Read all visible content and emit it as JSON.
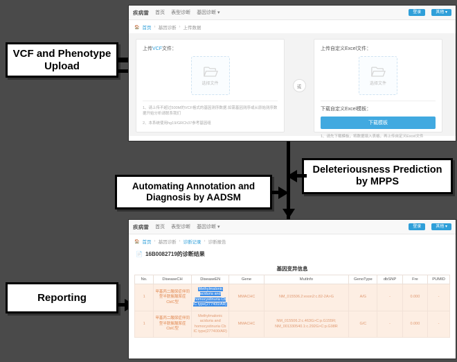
{
  "diagram": {
    "background_color": "#4a4a4a",
    "callouts": [
      {
        "id": "upload",
        "text": "VCF and Phenotype Upload"
      },
      {
        "id": "aadsm",
        "text": "Automating Annotation and Diagnosis by AADSM"
      },
      {
        "id": "mpps",
        "text": "Deleteriousness Prediction by MPPS"
      },
      {
        "id": "report",
        "text": "Reporting"
      }
    ]
  },
  "upload_window": {
    "navbar": {
      "brand": "疾病雷",
      "items": [
        {
          "label": "首页"
        },
        {
          "label": "表型诊断"
        },
        {
          "label": "基因诊断 ▾"
        }
      ],
      "buttons": [
        {
          "label": "登录"
        },
        {
          "label": "其他 ▾"
        }
      ],
      "accent_color": "#2f9fd9"
    },
    "breadcrumb": {
      "home_icon": "home-icon",
      "items": [
        "首页",
        "基因诊断",
        "上传数据"
      ]
    },
    "left_panel": {
      "label_prefix": "上传",
      "label_highlight": "VCF",
      "label_suffix": "文件：",
      "dropzone": {
        "icon": "folder-open-icon",
        "text": "选择文件"
      },
      "notes": [
        "1、请上传不超过500M的VCF格式的基因测序数据.如需基因测序或从原始测序数据开始分析请联系我们",
        "2、本系统使用hg19/GRCh37参考基因组"
      ]
    },
    "middle": {
      "or_label": "或"
    },
    "right_panel": {
      "upload_label": "上传自定义Excel文件：",
      "dropzone": {
        "icon": "folder-open-icon",
        "text": "选择文件"
      },
      "download_label": "下载自定义Excel模板：",
      "download_button": "下载模板",
      "note": "1、请先下载模板，将数据填入表格，再上传自定义Excel文件"
    }
  },
  "report_window": {
    "navbar": {
      "brand": "疾病雷",
      "items": [
        {
          "label": "首页"
        },
        {
          "label": "表型诊断"
        },
        {
          "label": "基因诊断 ▾"
        }
      ],
      "buttons": [
        {
          "label": "登录"
        },
        {
          "label": "其他 ▾"
        }
      ]
    },
    "breadcrumb": {
      "home_icon": "home-icon",
      "items": [
        "首页",
        "基因诊断",
        "诊断记录",
        "诊断报告"
      ]
    },
    "title": "16B0082719的诊断结果",
    "table_caption": "基因变异信息",
    "table": {
      "headers": [
        "No.",
        "DiseaseCH",
        "DiseaseEN",
        "Gene",
        "MutInfo",
        "GenoType",
        "dbSNP",
        "Fre",
        "PUMID"
      ],
      "rows": [
        {
          "no": "1",
          "disease_ch": "甲基丙二酸尿症伴同型半胱氨酸尿症CblC型",
          "disease_en": "Methylmalonic aciduria and homocystinuria Cb lC type(277400/AR)",
          "disease_en_selected": true,
          "gene": "MMACHC",
          "mut_info": "NM_015506.2:exon2:c.82-2A>G",
          "geno_type": "A/G",
          "db_snp": "-",
          "fre": "0.000",
          "pumid": "-"
        },
        {
          "no": "1",
          "disease_ch": "甲基丙二酸尿症伴同型半胱氨酸尿症CblC型",
          "disease_en": "Methylmalonic aciduria and homocystinuria Cb lC type(277400/AR)",
          "disease_en_selected": false,
          "gene": "MMACHC",
          "mut_info": "NM_015506.2:c.463G>C:p.G155R; NM_001330540.1:c.292G>C:p.G98R",
          "geno_type": "G/C",
          "db_snp": "-",
          "fre": "0.000",
          "pumid": "-"
        }
      ]
    }
  }
}
